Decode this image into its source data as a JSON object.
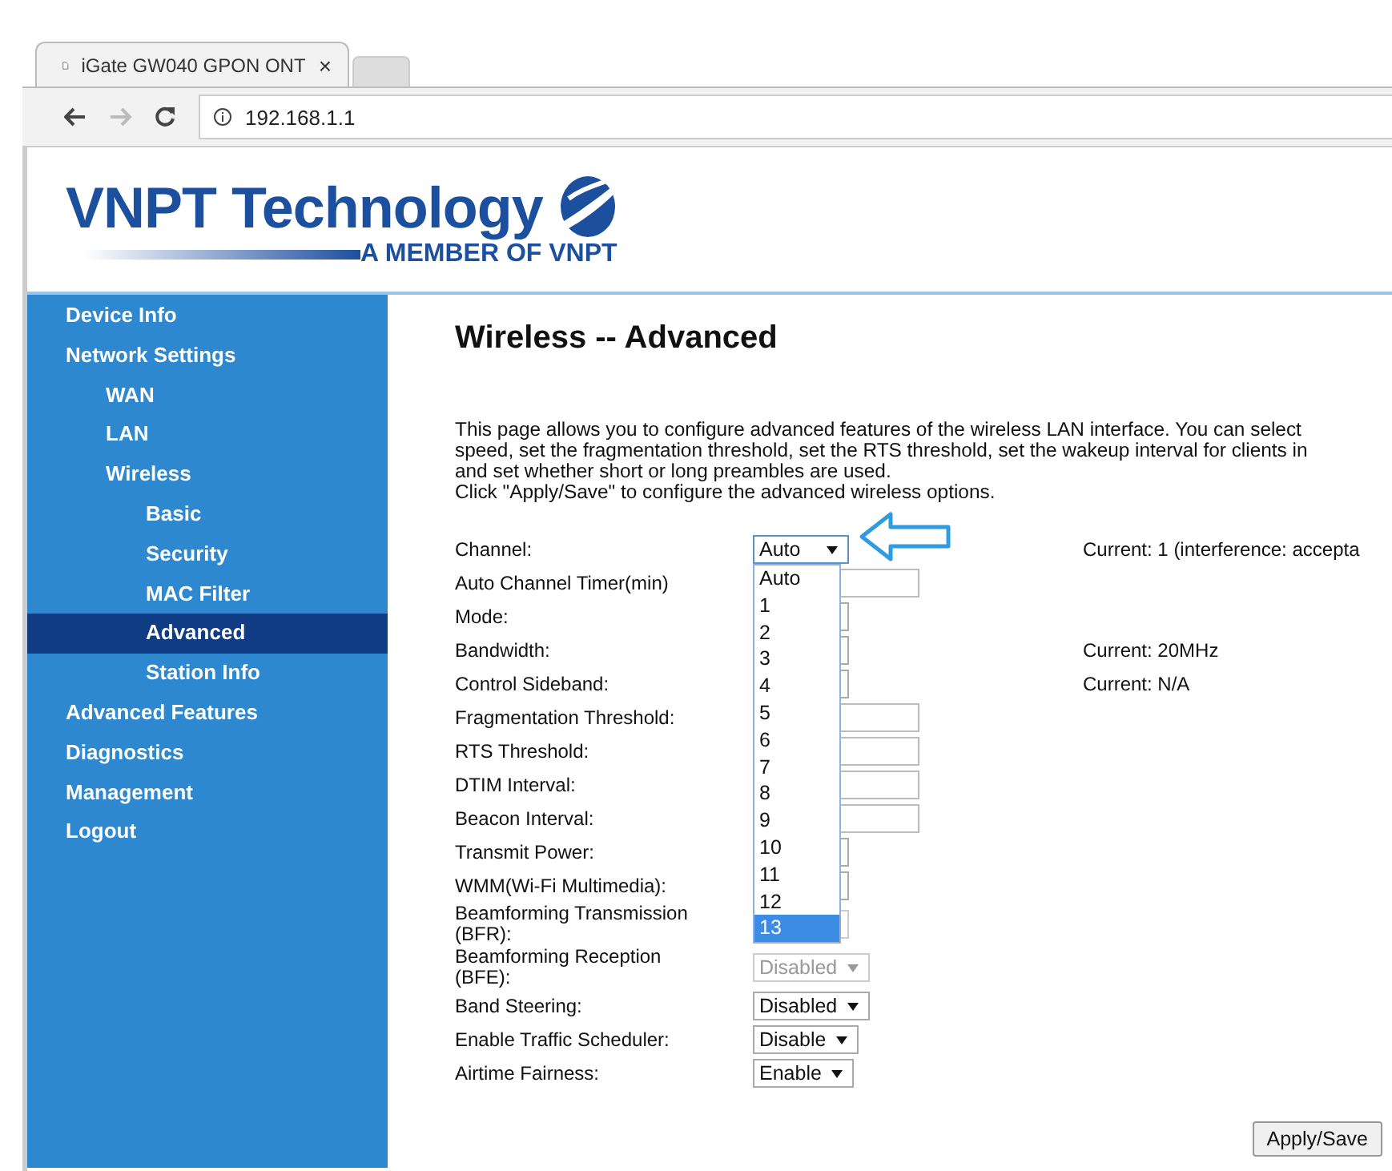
{
  "browser": {
    "tab": {
      "title": "iGate GW040 GPON ONT",
      "close": "×"
    },
    "address": "192.168.1.1"
  },
  "logo": {
    "name": "VNPT Technology",
    "tagline": "A MEMBER OF VNPT"
  },
  "sidebar": {
    "items": [
      {
        "label": "Device Info",
        "selected": false
      },
      {
        "label": "Network Settings",
        "selected": false,
        "children": [
          {
            "label": "WAN",
            "selected": false
          },
          {
            "label": "LAN",
            "selected": false
          },
          {
            "label": "Wireless",
            "selected": false,
            "children": [
              {
                "label": "Basic",
                "selected": false
              },
              {
                "label": "Security",
                "selected": false
              },
              {
                "label": "MAC Filter",
                "selected": false
              },
              {
                "label": "Advanced",
                "selected": true
              },
              {
                "label": "Station Info",
                "selected": false
              }
            ]
          }
        ]
      },
      {
        "label": "Advanced Features",
        "selected": false
      },
      {
        "label": "Diagnostics",
        "selected": false
      },
      {
        "label": "Management",
        "selected": false
      },
      {
        "label": "Logout",
        "selected": false
      }
    ]
  },
  "page": {
    "title": "Wireless -- Advanced",
    "description": [
      "This page allows you to configure advanced features of the wireless LAN interface. You can select",
      "speed, set the fragmentation threshold, set the RTS threshold, set the wakeup interval for clients in",
      "and set whether short or long preambles are used.",
      "Click \"Apply/Save\" to configure the advanced wireless options."
    ]
  },
  "fields": [
    {
      "kind": "select",
      "label": "Channel:",
      "value": "Auto",
      "expanded": true,
      "disabled": false,
      "note": "Current: 1 (interference: accepta"
    },
    {
      "kind": "text",
      "label": "Auto Channel Timer(min)"
    },
    {
      "kind": "select",
      "label": "Mode:",
      "expanded": false,
      "disabled": false
    },
    {
      "kind": "select",
      "label": "Bandwidth:",
      "expanded": false,
      "disabled": false,
      "note": "Current: 20MHz"
    },
    {
      "kind": "select",
      "label": "Control Sideband:",
      "expanded": false,
      "disabled": false,
      "note": "Current: N/A"
    },
    {
      "kind": "text",
      "label": "Fragmentation Threshold:"
    },
    {
      "kind": "text",
      "label": "RTS Threshold:"
    },
    {
      "kind": "text",
      "label": "DTIM Interval:"
    },
    {
      "kind": "text",
      "label": "Beacon Interval:"
    },
    {
      "kind": "select",
      "label": "Transmit Power:",
      "expanded": false,
      "disabled": false
    },
    {
      "kind": "select",
      "label": "WMM(Wi-Fi Multimedia):",
      "expanded": false,
      "disabled": false
    },
    {
      "kind": "select",
      "label": "Beamforming Transmission (BFR):",
      "expanded": false,
      "disabled": true
    },
    {
      "kind": "select",
      "label": "Beamforming Reception (BFE):",
      "value": "Disabled",
      "expanded": false,
      "disabled": true
    },
    {
      "kind": "select",
      "label": "Band Steering:",
      "value": "Disabled",
      "expanded": false,
      "disabled": false
    },
    {
      "kind": "select",
      "label": "Enable Traffic Scheduler:",
      "value": "Disable",
      "expanded": false,
      "disabled": false
    },
    {
      "kind": "select",
      "label": "Airtime Fairness:",
      "value": "Enable",
      "expanded": false,
      "disabled": false
    }
  ],
  "channel_options": [
    {
      "label": "Auto",
      "selected": false
    },
    {
      "label": "1",
      "selected": false
    },
    {
      "label": "2",
      "selected": false
    },
    {
      "label": "3",
      "selected": false
    },
    {
      "label": "4",
      "selected": false
    },
    {
      "label": "5",
      "selected": false
    },
    {
      "label": "6",
      "selected": false
    },
    {
      "label": "7",
      "selected": false
    },
    {
      "label": "8",
      "selected": false
    },
    {
      "label": "9",
      "selected": false
    },
    {
      "label": "10",
      "selected": false
    },
    {
      "label": "11",
      "selected": false
    },
    {
      "label": "12",
      "selected": false
    },
    {
      "label": "13",
      "selected": true
    }
  ],
  "apply_button": "Apply/Save"
}
